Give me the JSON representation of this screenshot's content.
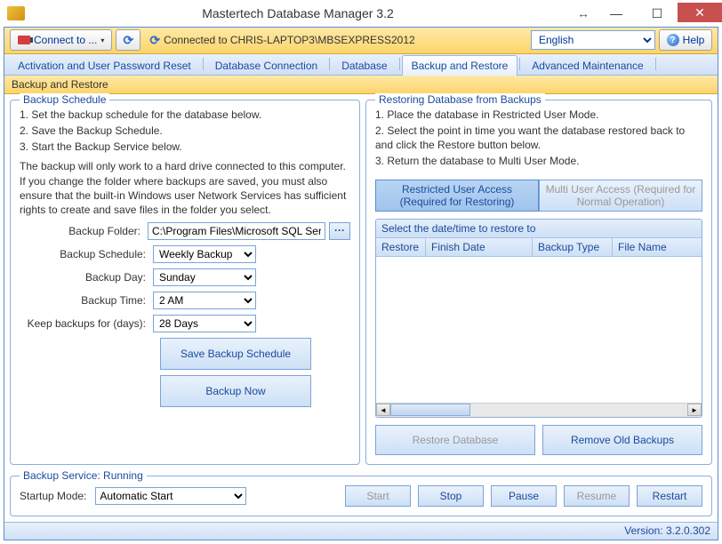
{
  "window": {
    "title": "Mastertech Database Manager 3.2"
  },
  "toolbar": {
    "connect_label": "Connect to ...",
    "status": "Connected to CHRIS-LAPTOP3\\MBSEXPRESS2012",
    "language": "English",
    "help_label": "Help"
  },
  "tabs": [
    "Activation and User Password Reset",
    "Database Connection",
    "Database",
    "Backup and Restore",
    "Advanced Maintenance"
  ],
  "active_tab_index": 3,
  "subheader": "Backup and Restore",
  "backup_schedule": {
    "legend": "Backup Schedule",
    "instructions": [
      "1. Set the backup schedule for the database below.",
      "2. Save the Backup Schedule.",
      "3. Start the Backup Service below."
    ],
    "note": "The backup will only work to a hard drive connected to this computer. If you change the folder where backups are saved, you must also ensure that the built-in Windows user Network Services has sufficient rights to create and save files in the folder you select.",
    "folder_label": "Backup Folder:",
    "folder_value": "C:\\Program Files\\Microsoft SQL Server\\",
    "schedule_label": "Backup Schedule:",
    "schedule_value": "Weekly Backup",
    "day_label": "Backup Day:",
    "day_value": "Sunday",
    "time_label": "Backup Time:",
    "time_value": "2 AM",
    "keep_label": "Keep backups for (days):",
    "keep_value": "28 Days",
    "save_btn": "Save Backup Schedule",
    "now_btn": "Backup Now"
  },
  "restore": {
    "legend": "Restoring Database from Backups",
    "instructions": [
      "1. Place the database in Restricted User Mode.",
      "2. Select the point in time you want the database restored back to and click the Restore button below.",
      "3. Return the database to Multi User Mode."
    ],
    "restricted_btn": "Restricted User Access (Required for Restoring)",
    "multi_btn": "Multi User Access (Required for Normal Operation)",
    "grid_title": "Select the date/time to restore to",
    "cols": [
      "Restore",
      "Finish Date",
      "Backup Type",
      "File Name"
    ],
    "restore_btn": "Restore Database",
    "remove_btn": "Remove Old Backups"
  },
  "service": {
    "legend": "Backup Service: Running",
    "startup_label": "Startup Mode:",
    "startup_value": "Automatic Start",
    "buttons": {
      "start": "Start",
      "stop": "Stop",
      "pause": "Pause",
      "resume": "Resume",
      "restart": "Restart"
    }
  },
  "statusbar": {
    "version": "Version: 3.2.0.302"
  }
}
